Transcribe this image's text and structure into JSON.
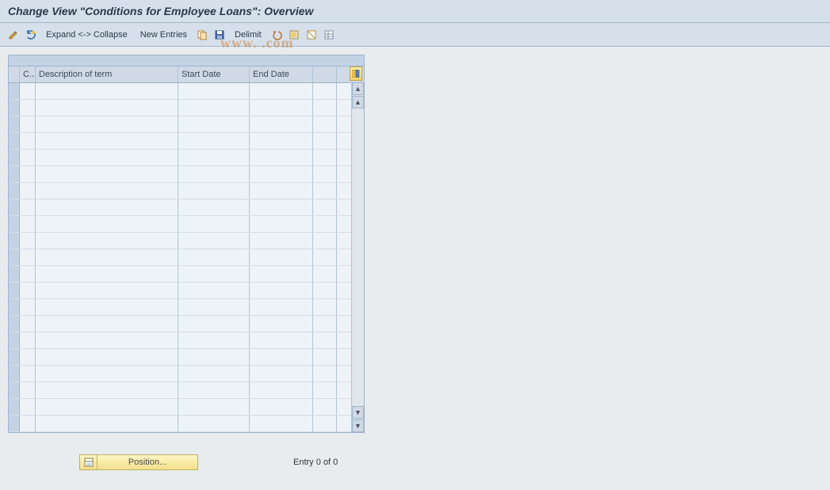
{
  "title": "Change View \"Conditions for Employee Loans\": Overview",
  "toolbar": {
    "expand_collapse": "Expand <-> Collapse",
    "new_entries": "New Entries",
    "delimit": "Delimit"
  },
  "grid": {
    "columns": {
      "c": "C..",
      "desc": "Description of term",
      "start": "Start Date",
      "end": "End Date"
    },
    "row_count": 21
  },
  "footer": {
    "position_label": "Position...",
    "entry_status": "Entry 0 of 0"
  },
  "watermark": "www.               .com"
}
